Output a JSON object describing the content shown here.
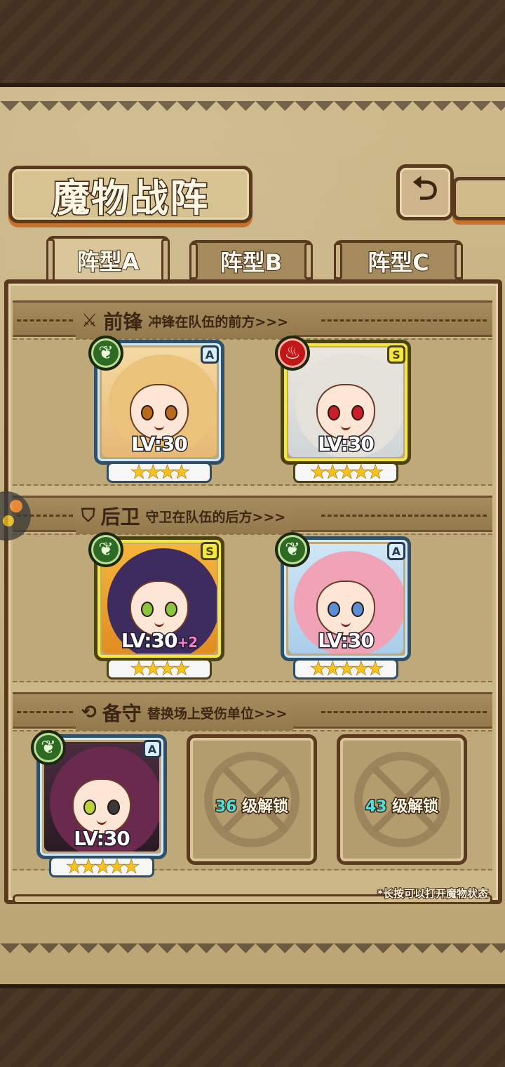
{
  "header": {
    "title": "魔物战阵"
  },
  "tabs": [
    {
      "label": "阵型A",
      "active": true
    },
    {
      "label": "阵型B",
      "active": false
    },
    {
      "label": "阵型C",
      "active": false
    }
  ],
  "sections": {
    "front": {
      "icon": "sword-icon",
      "title": "前锋",
      "desc": "冲锋在队伍的前方>>>"
    },
    "back": {
      "icon": "shield-icon",
      "title": "后卫",
      "desc": "守卫在队伍的后方>>>"
    },
    "bench": {
      "icon": "swap-icon",
      "title": "备守",
      "desc": "替换场上受伤单位>>>"
    }
  },
  "cards": [
    {
      "rank": "A",
      "element": "leaf",
      "level": "LV:30",
      "plus": "",
      "stars": "★★★★"
    },
    {
      "rank": "S",
      "element": "fire",
      "level": "LV:30",
      "plus": "",
      "stars": "★★★★★"
    },
    {
      "rank": "S",
      "element": "leaf",
      "level": "LV:30",
      "plus": "+2",
      "stars": "★★★★"
    },
    {
      "rank": "A",
      "element": "leaf",
      "level": "LV:30",
      "plus": "",
      "stars": "★★★★★"
    },
    {
      "rank": "A",
      "element": "leaf",
      "level": "LV:30",
      "plus": "",
      "stars": "★★★★★"
    }
  ],
  "locked_slots": [
    {
      "level": "36",
      "text": "级解锁"
    },
    {
      "level": "43",
      "text": "级解锁"
    }
  ],
  "hint": "*长按可以打开魔物状态",
  "colors": {
    "paper": "#cbb687",
    "frame": "#5a3a1e",
    "accent": "#c7722c",
    "unlock_number": "#4fe0df"
  }
}
